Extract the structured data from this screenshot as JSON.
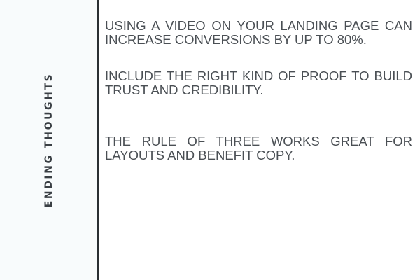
{
  "sidebar": {
    "title": "ENDING THOUGHTS"
  },
  "points": [
    "USING A VIDEO ON YOUR LANDING PAGE CAN INCREASE CONVERSIONS BY UP TO 80%.",
    "INCLUDE THE RIGHT KIND OF PROOF TO BUILD TRUST AND CREDIBILITY.",
    "THE RULE OF THREE WORKS GREAT FOR LAYOUTS AND BENEFIT COPY."
  ],
  "colors": {
    "sidebar_bg": "#f8fbfc",
    "divider": "#2a2f33",
    "text": "#4a4f54"
  }
}
